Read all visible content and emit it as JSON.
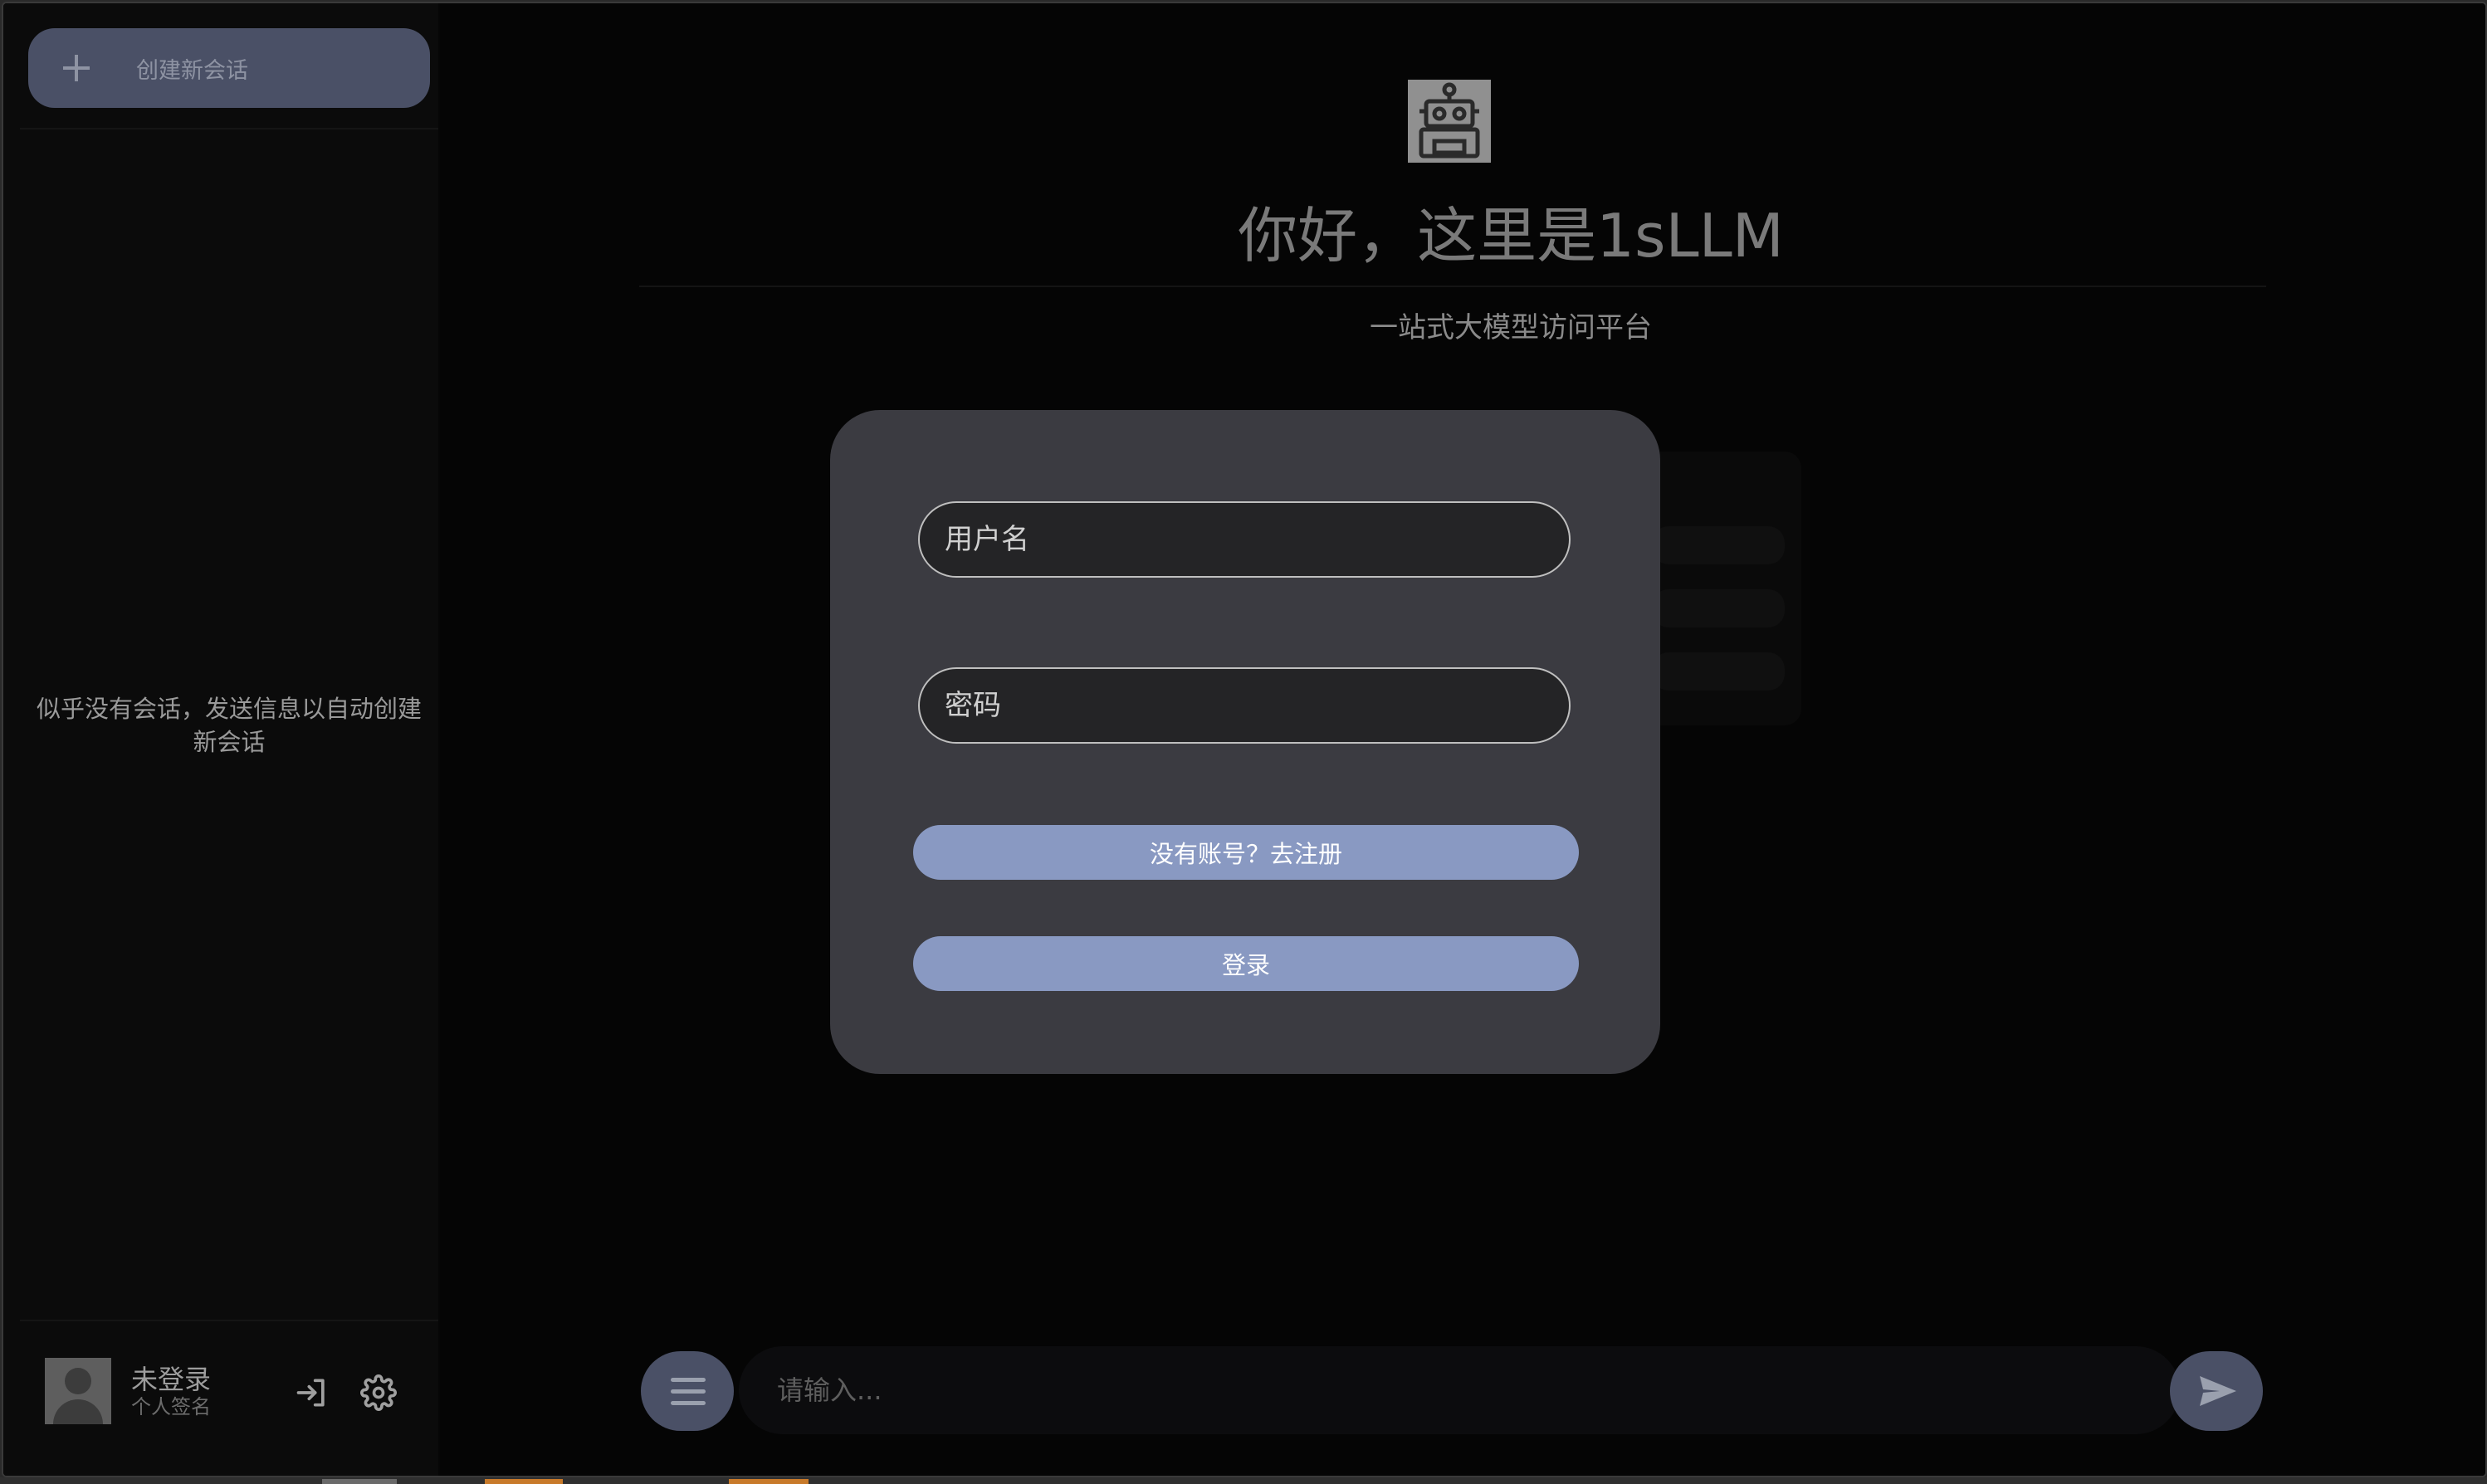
{
  "sidebar": {
    "new_chat_label": "创建新会话",
    "empty_tip": "似乎没有会话，发送信息以自动创建新会话",
    "user": {
      "name": "未登录",
      "signature": "个人签名"
    }
  },
  "main": {
    "greeting": "你好，这里是1sLLM",
    "subtitle": "一站式大模型访问平台"
  },
  "login_dialog": {
    "username_placeholder": "用户名",
    "password_placeholder": "密码",
    "register_label": "没有账号？去注册",
    "login_label": "登录"
  },
  "composer": {
    "placeholder": "请输入..."
  },
  "icons": {
    "new_chat": "plus-icon",
    "login": "login-icon",
    "settings": "gear-icon",
    "menu": "menu-icon",
    "send": "send-icon",
    "logo": "robot-icon",
    "avatar": "user-avatar-icon"
  },
  "colors": {
    "accent_button": "#8999c2",
    "secondary_button": "#4a5066",
    "dialog_bg": "#3b3b41",
    "app_bg": "#050505"
  }
}
